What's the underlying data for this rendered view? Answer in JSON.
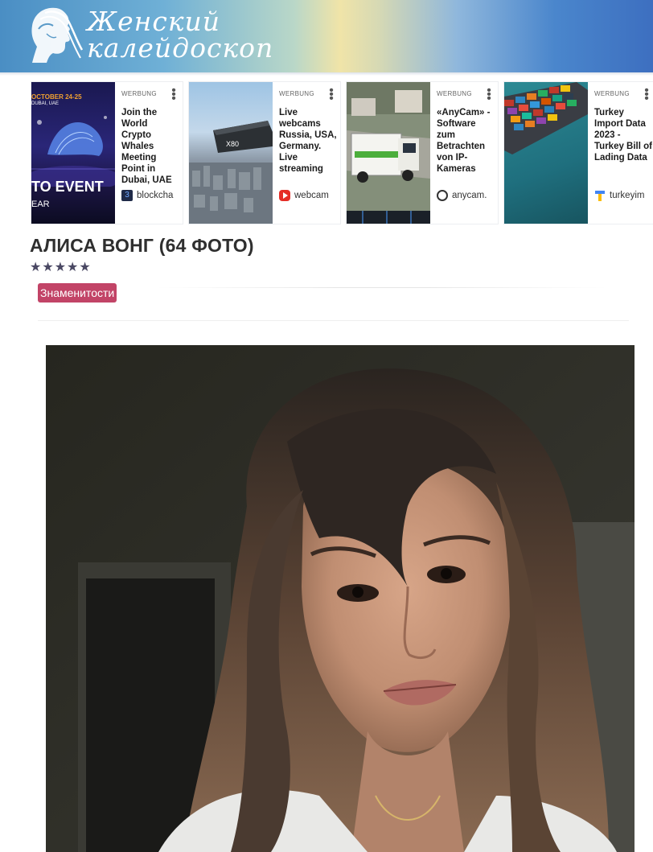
{
  "site": {
    "logo_line1": "Женский",
    "logo_line2": "калейдоскоп"
  },
  "ads": [
    {
      "label": "WERBUNG",
      "title": "Join the World Crypto Whales Meeting Point in Dubai, UAE",
      "source": "blockcha",
      "image_texts": {
        "date": "OCTOBER 24-25",
        "place": "DUBAI, UAE",
        "event": "TO EVENT",
        "year": "EAR"
      }
    },
    {
      "label": "WERBUNG",
      "title": "Live webcams Russia, USA, Germany. Live streaming",
      "source": "webcam",
      "image_texts": {
        "camera": "X80"
      }
    },
    {
      "label": "WERBUNG",
      "title": "«AnyCam» - Software zum Betrachten von IP-Kameras",
      "source": "anycam.",
      "image_texts": {}
    },
    {
      "label": "WERBUNG",
      "title": "Turkey Import Data 2023 - Turkey Bill of Lading Data",
      "source": "turkeyim",
      "image_texts": {}
    }
  ],
  "article": {
    "title": "АЛИСА ВОНГ (64 ФОТО)",
    "stars": "★★★★★",
    "rating": 5,
    "category": "Знаменитости"
  },
  "colors": {
    "tag_bg": "#c24467",
    "star": "#4a4863",
    "title": "#2f2f2f"
  }
}
